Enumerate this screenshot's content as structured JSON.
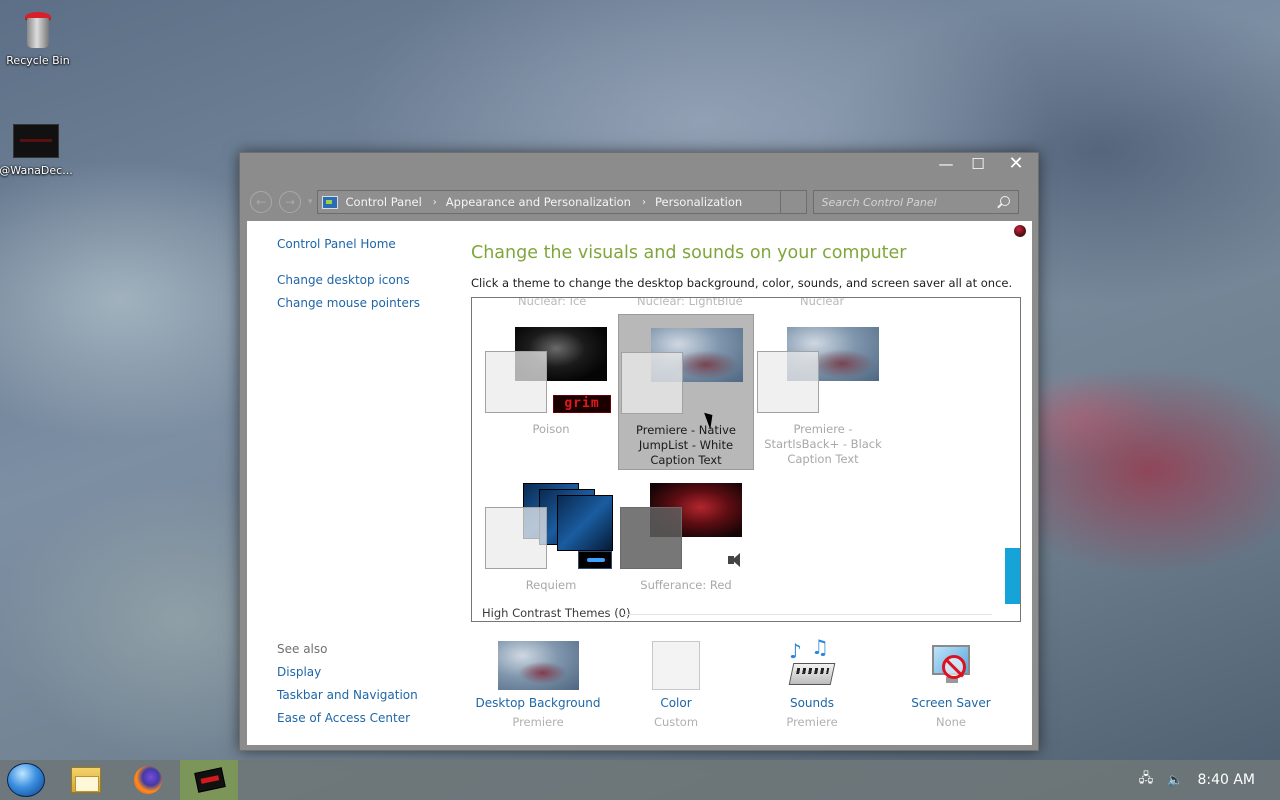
{
  "desktop": {
    "icons": [
      {
        "label": "Recycle Bin",
        "icon": "recycle-bin-icon"
      },
      {
        "label": "@WanaDec...",
        "icon": "wanadecryptor-icon"
      }
    ]
  },
  "window": {
    "controls": {
      "minimize": "—",
      "maximize": "☐",
      "close": "✕"
    },
    "nav": {
      "back": "←",
      "forward": "→",
      "dropdown": "▾"
    },
    "breadcrumb": [
      "Control Panel",
      "Appearance and Personalization",
      "Personalization"
    ],
    "breadcrumb_sep": "›",
    "search": {
      "placeholder": "Search Control Panel"
    }
  },
  "sidebar": {
    "home": "Control Panel Home",
    "links": [
      "Change desktop icons",
      "Change mouse pointers"
    ],
    "see_also_heading": "See also",
    "see_also": [
      "Display",
      "Taskbar and Navigation",
      "Ease of Access Center"
    ]
  },
  "main": {
    "title": "Change the visuals and sounds on your computer",
    "description": "Click a theme to change the desktop background, color, sounds, and screen saver all at once.",
    "faded_row": [
      "Nuclear: Ice",
      "Nuclear: LightBlue",
      "Nuclear"
    ],
    "themes": [
      {
        "name": "Poison",
        "selected": false
      },
      {
        "name": "Premiere - Native JumpList - White Caption Text",
        "selected": true
      },
      {
        "name": "Premiere - StartIsBack+ - Black Caption Text",
        "selected": false
      },
      {
        "name": "Requiem",
        "selected": false
      },
      {
        "name": "Sufferance: Red",
        "selected": false
      }
    ],
    "grim_badge": "grim",
    "high_contrast": "High Contrast Themes (0)",
    "accent_color": "#16a4d8",
    "title_color": "#7fa63a",
    "link_color": "#1e66a8"
  },
  "bottom": [
    {
      "label": "Desktop Background",
      "value": "Premiere"
    },
    {
      "label": "Color",
      "value": "Custom"
    },
    {
      "label": "Sounds",
      "value": "Premiere"
    },
    {
      "label": "Screen Saver",
      "value": "None"
    }
  ],
  "taskbar": {
    "apps": [
      "file-explorer-icon",
      "firefox-icon",
      "wanacry-app-icon"
    ],
    "clock": "8:40 AM"
  }
}
